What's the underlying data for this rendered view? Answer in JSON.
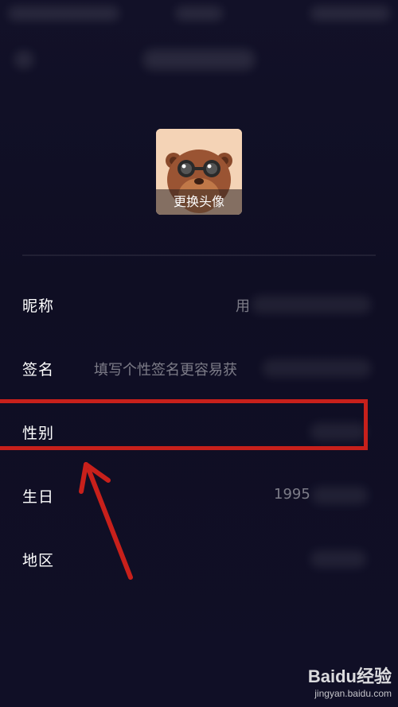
{
  "avatar": {
    "change_label": "更换头像"
  },
  "rows": [
    {
      "label": "昵称",
      "value": "用"
    },
    {
      "label": "签名",
      "value": "填写个性签名更容易获"
    },
    {
      "label": "性别",
      "value": ""
    },
    {
      "label": "生日",
      "value": "1995"
    },
    {
      "label": "地区",
      "value": ""
    }
  ],
  "watermark": {
    "brand": "Baidu经验",
    "url": "jingyan.baidu.com"
  },
  "colors": {
    "background": "#0f0e24",
    "highlight": "#c8201b",
    "avatar_bg": "#f4d3b6"
  }
}
